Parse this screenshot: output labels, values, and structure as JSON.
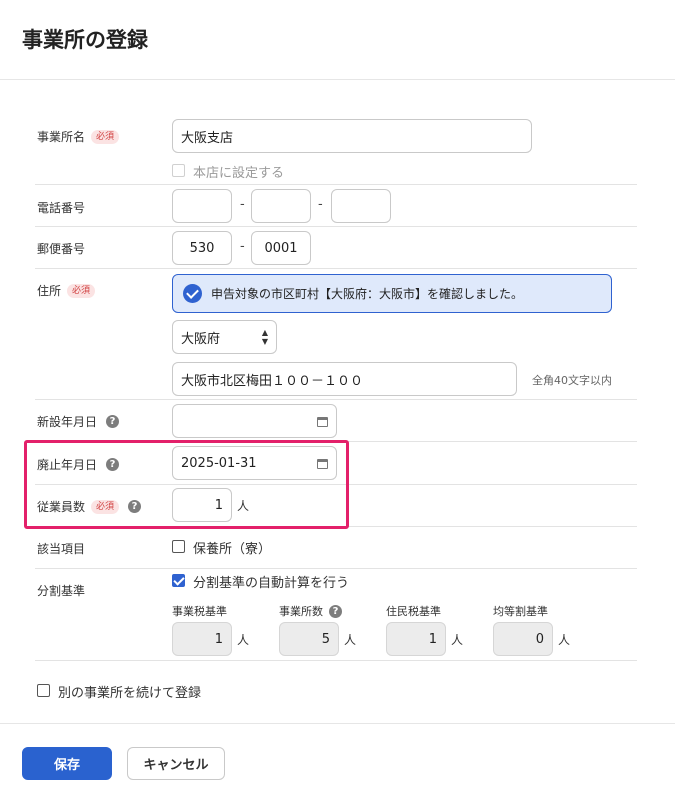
{
  "page": {
    "title": "事業所の登録"
  },
  "required_badge": "必須",
  "help_glyph": "?",
  "fields": {
    "office_name": {
      "label": "事業所名",
      "value": "大阪支店"
    },
    "head_office": {
      "label": "本店に設定する",
      "checked": false,
      "disabled": true
    },
    "phone": {
      "label": "電話番号",
      "parts": [
        "",
        "",
        ""
      ],
      "separator": "-"
    },
    "postal": {
      "label": "郵便番号",
      "parts": [
        "530",
        "0001"
      ],
      "separator": "-"
    },
    "address": {
      "label": "住所",
      "notice": "申告対象の市区町村【大阪府：大阪市】を確認しました。",
      "prefecture": "大阪府",
      "street": "大阪市北区梅田１００－１００",
      "hint": "全角40文字以内"
    },
    "established": {
      "label": "新設年月日",
      "value": ""
    },
    "abolished": {
      "label": "廃止年月日",
      "value": "2025-01-31"
    },
    "employees": {
      "label": "従業員数",
      "value": "1",
      "unit": "人"
    },
    "applicable": {
      "label": "該当項目",
      "option": "保養所（寮）",
      "checked": false
    },
    "split_basis": {
      "label": "分割基準",
      "auto_calc_label": "分割基準の自動計算を行う",
      "auto_calc_checked": true,
      "unit": "人",
      "columns": [
        {
          "label": "事業税基準",
          "value": "1",
          "help": false
        },
        {
          "label": "事業所数",
          "value": "5",
          "help": true
        },
        {
          "label": "住民税基準",
          "value": "1",
          "help": false
        },
        {
          "label": "均等割基準",
          "value": "0",
          "help": false
        }
      ]
    }
  },
  "continue_register": {
    "label": "別の事業所を続けて登録",
    "checked": false
  },
  "buttons": {
    "save": "保存",
    "cancel": "キャンセル"
  },
  "colors": {
    "primary": "#2a62cf",
    "highlight": "#e3206a",
    "notice_bg": "#dfe9fb",
    "required": "#d04040"
  }
}
